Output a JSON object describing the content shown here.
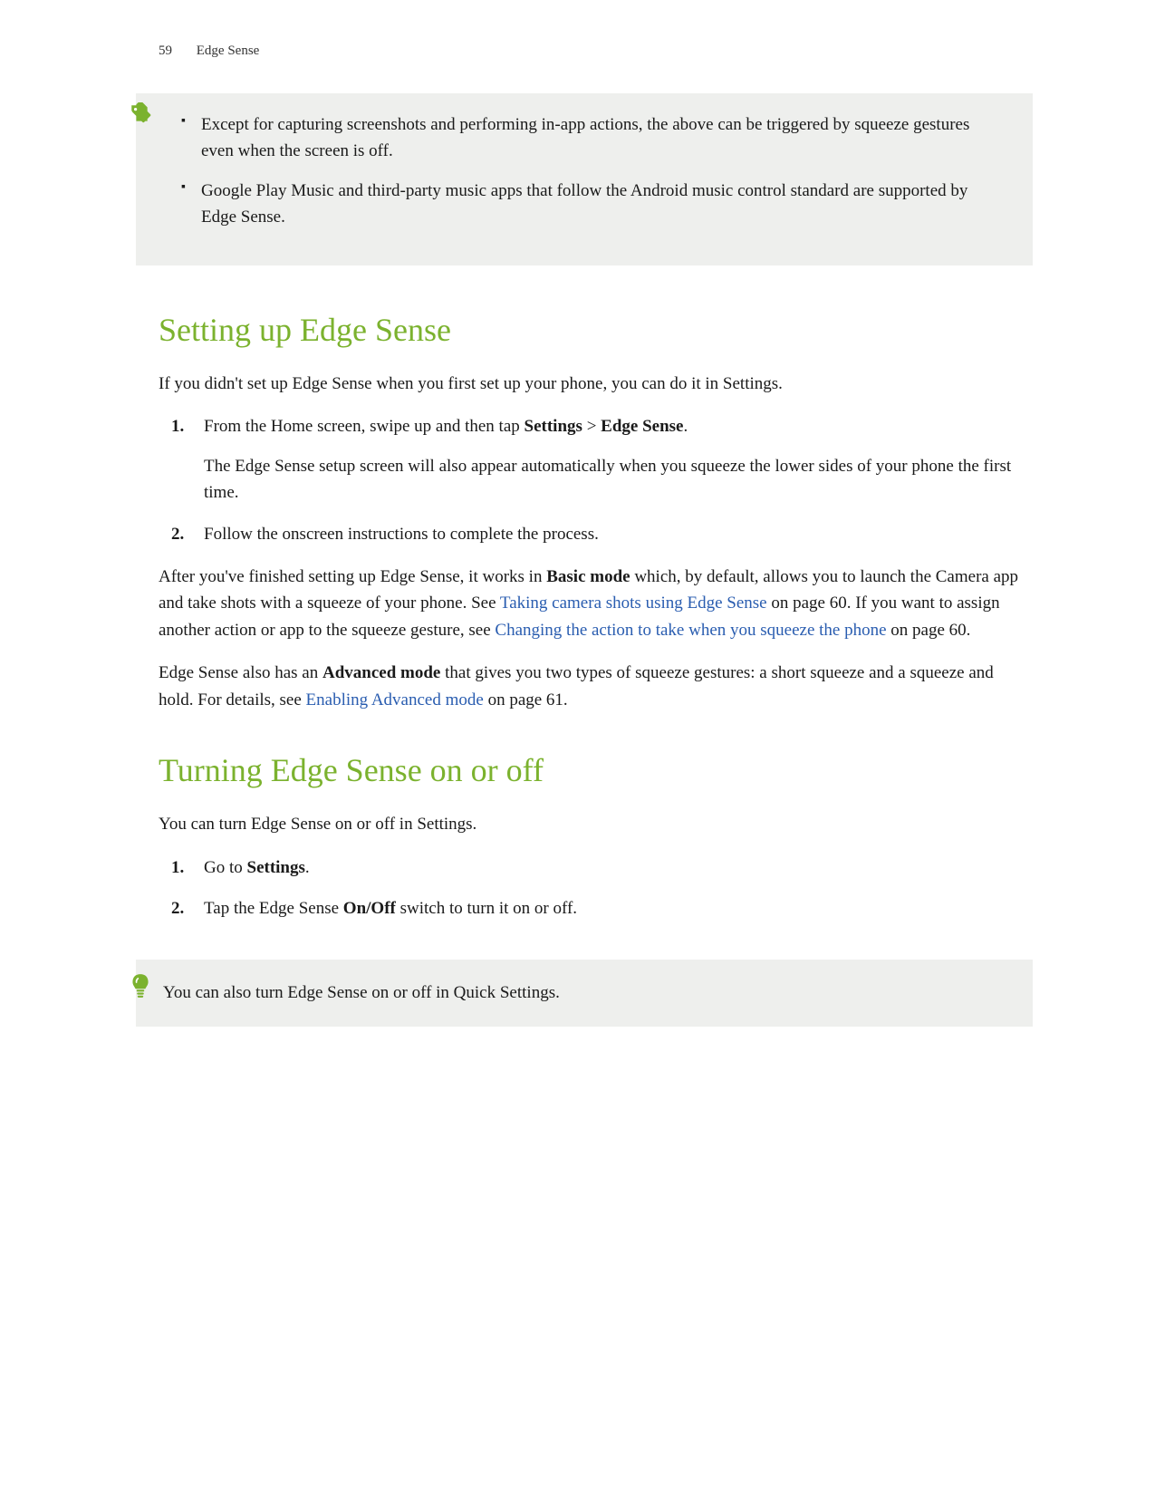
{
  "header": {
    "page_number": "59",
    "section_title": "Edge Sense"
  },
  "note": {
    "bullets": [
      "Except for capturing screenshots and performing in-app actions, the above can be triggered by squeeze gestures even when the screen is off.",
      "Google Play Music and third-party music apps that follow the Android music control standard are supported by Edge Sense."
    ]
  },
  "section1": {
    "heading": "Setting up Edge Sense",
    "intro": "If you didn't set up Edge Sense when you first set up your phone, you can do it in Settings.",
    "steps": [
      {
        "num": "1.",
        "text_before": "From the Home screen, swipe up and then tap ",
        "bold1": "Settings",
        "sep": " > ",
        "bold2": "Edge Sense",
        "text_after": ".",
        "sub": "The Edge Sense setup screen will also appear automatically when you squeeze the lower sides of your phone the first time."
      },
      {
        "num": "2.",
        "text": "Follow the onscreen instructions to complete the process."
      }
    ],
    "para1": {
      "t1": "After you've finished setting up Edge Sense, it works in ",
      "b1": "Basic mode",
      "t2": " which, by default, allows you to launch the Camera app and take shots with a squeeze of your phone. See ",
      "link1": "Taking camera shots using Edge Sense",
      "t3": " on page 60. If you want to assign another action or app to the squeeze gesture, see ",
      "link2": "Changing the action to take when you squeeze the phone",
      "t4": " on page 60."
    },
    "para2": {
      "t1": "Edge Sense also has an ",
      "b1": "Advanced mode",
      "t2": " that gives you two types of squeeze gestures: a short squeeze and a squeeze and hold. For details, see ",
      "link1": "Enabling Advanced mode",
      "t3": " on page 61."
    }
  },
  "section2": {
    "heading": "Turning Edge Sense on or off",
    "intro": "You can turn Edge Sense on or off in Settings.",
    "steps": [
      {
        "num": "1.",
        "t1": "Go to ",
        "b1": "Settings",
        "t2": "."
      },
      {
        "num": "2.",
        "t1": "Tap the Edge Sense ",
        "b1": "On/Off",
        "t2": " switch to turn it on or off."
      }
    ]
  },
  "tip": {
    "text": "You can also turn Edge Sense on or off in Quick Settings."
  }
}
